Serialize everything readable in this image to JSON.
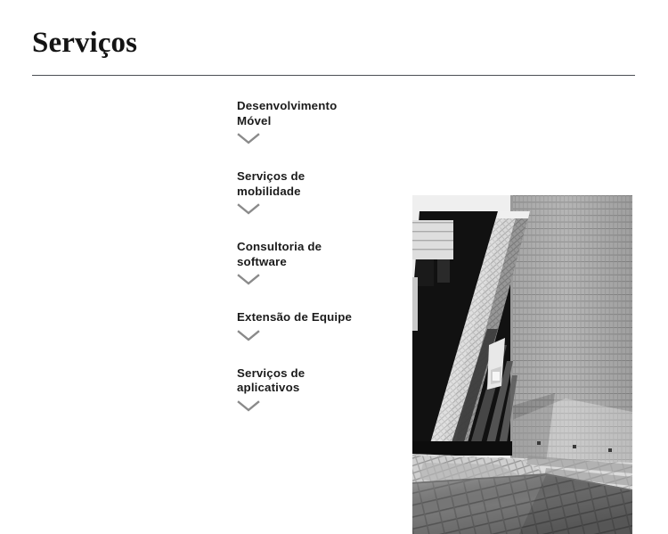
{
  "header": {
    "title": "Serviços",
    "divider": "horizontal-rule"
  },
  "services": {
    "toggle_icon": "chevron-down-icon",
    "items": [
      {
        "label": "Desenvolvimento\nMóvel",
        "lines": 2
      },
      {
        "label": "Serviços de\nmobilidade",
        "lines": 2
      },
      {
        "label": "Consultoria de\nsoftware",
        "lines": 2
      },
      {
        "label": "Extensão de Equipe",
        "lines": 1
      },
      {
        "label": "Serviços de\naplicativos",
        "lines": 2
      }
    ]
  },
  "media": {
    "name": "architecture-photo",
    "description": "Black and white photograph of a modern tiled concrete building with angled colonnade beams and a paved plaza in sunlight"
  },
  "colors": {
    "background": "#ffffff",
    "title_text": "#141414",
    "body_text": "#1b1b1b",
    "divider": "#4b4f54",
    "chevron": "#8a8a8a"
  }
}
